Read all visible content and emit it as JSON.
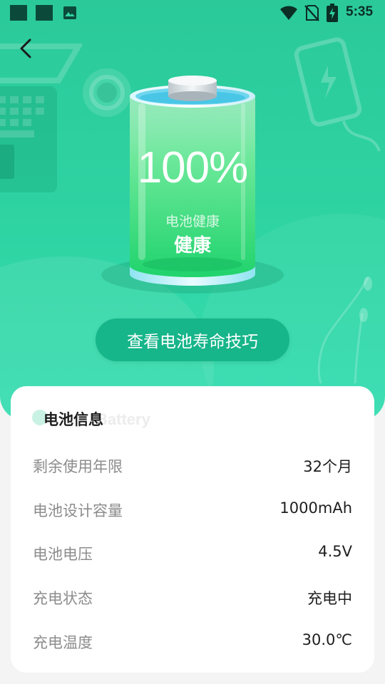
{
  "status_bar": {
    "time": "5:35",
    "icons": [
      "app-square-icon",
      "app-square-icon",
      "image-icon",
      "wifi-icon",
      "no-sim-icon",
      "battery-charging-icon"
    ]
  },
  "header": {
    "back_icon": "chevron-left-icon"
  },
  "battery": {
    "percent": "100%",
    "level": 1.0,
    "health_label": "电池健康",
    "health_value": "健康"
  },
  "tips_button": {
    "label": "查看电池寿命技巧"
  },
  "info_card": {
    "title": "电池信息",
    "watermark": "Battery",
    "rows": [
      {
        "label": "剩余使用年限",
        "value": "32个月"
      },
      {
        "label": "电池设计容量",
        "value": "1000mAh"
      },
      {
        "label": "电池电压",
        "value": "4.5V"
      },
      {
        "label": "充电状态",
        "value": "充电中"
      },
      {
        "label": "充电温度",
        "value": "30.0℃"
      }
    ]
  },
  "colors": {
    "hero_top": "#2bc99a",
    "hero_bottom": "#35ddb0",
    "button_bg": "#17b58a",
    "battery_green": "#2fe07f"
  }
}
